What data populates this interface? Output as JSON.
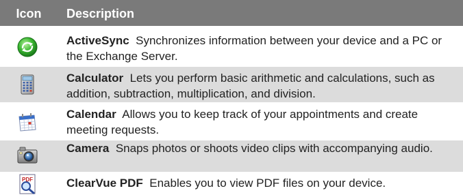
{
  "header": {
    "icon_label": "Icon",
    "description_label": "Description"
  },
  "rows": [
    {
      "name": "ActiveSync",
      "text": "Synchronizes information between your device and a PC or the Exchange Server.",
      "icon": "activesync-icon"
    },
    {
      "name": "Calculator",
      "text": "Lets you perform basic arithmetic and calculations, such as addition, subtraction, multiplication, and division.",
      "icon": "calculator-icon"
    },
    {
      "name": "Calendar",
      "text": "Allows you to keep track of your appointments and create meeting requests.",
      "icon": "calendar-icon"
    },
    {
      "name": "Camera",
      "text": "Snaps photos or shoots video clips with accompanying audio.",
      "icon": "camera-icon"
    },
    {
      "name": "ClearVue PDF",
      "text": "Enables you to view PDF files on your device.",
      "icon": "clearvue-pdf-icon"
    }
  ],
  "colors": {
    "header_bg": "#7a7a7a",
    "shaded_row_bg": "#dcdcdc",
    "text": "#222222"
  }
}
